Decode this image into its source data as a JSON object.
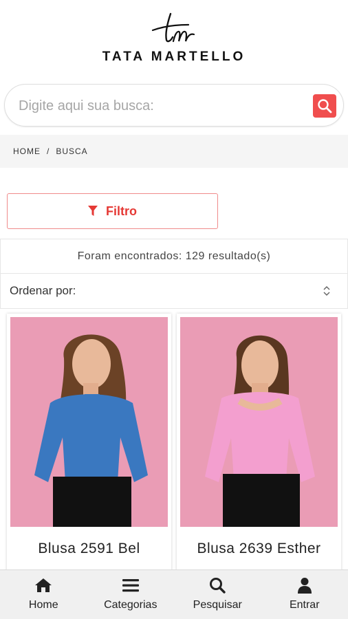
{
  "brand": {
    "name": "TATA MARTELLO",
    "monogram": "tm"
  },
  "search": {
    "placeholder": "Digite aqui sua busca:",
    "icon": "search-icon",
    "button_color": "#f04e4e"
  },
  "breadcrumb": {
    "items": [
      "HOME",
      "BUSCA"
    ],
    "separator": "/"
  },
  "filter": {
    "label": "Filtro",
    "icon": "filter-icon",
    "color": "#e53935"
  },
  "results": {
    "text": "Foram encontrados: 129 resultado(s)"
  },
  "sort": {
    "label": "Ordenar por:",
    "value": ""
  },
  "products": [
    {
      "name": "Blusa 2591 Bel",
      "blouse_color": "#3a78c0",
      "background": "#ea9cb5"
    },
    {
      "name": "Blusa 2639 Esther",
      "blouse_color": "#f39fcf",
      "background": "#ea9cb5"
    }
  ],
  "bottom_nav": [
    {
      "label": "Home",
      "icon": "home-icon"
    },
    {
      "label": "Categorias",
      "icon": "menu-icon"
    },
    {
      "label": "Pesquisar",
      "icon": "search-icon"
    },
    {
      "label": "Entrar",
      "icon": "user-icon"
    }
  ]
}
